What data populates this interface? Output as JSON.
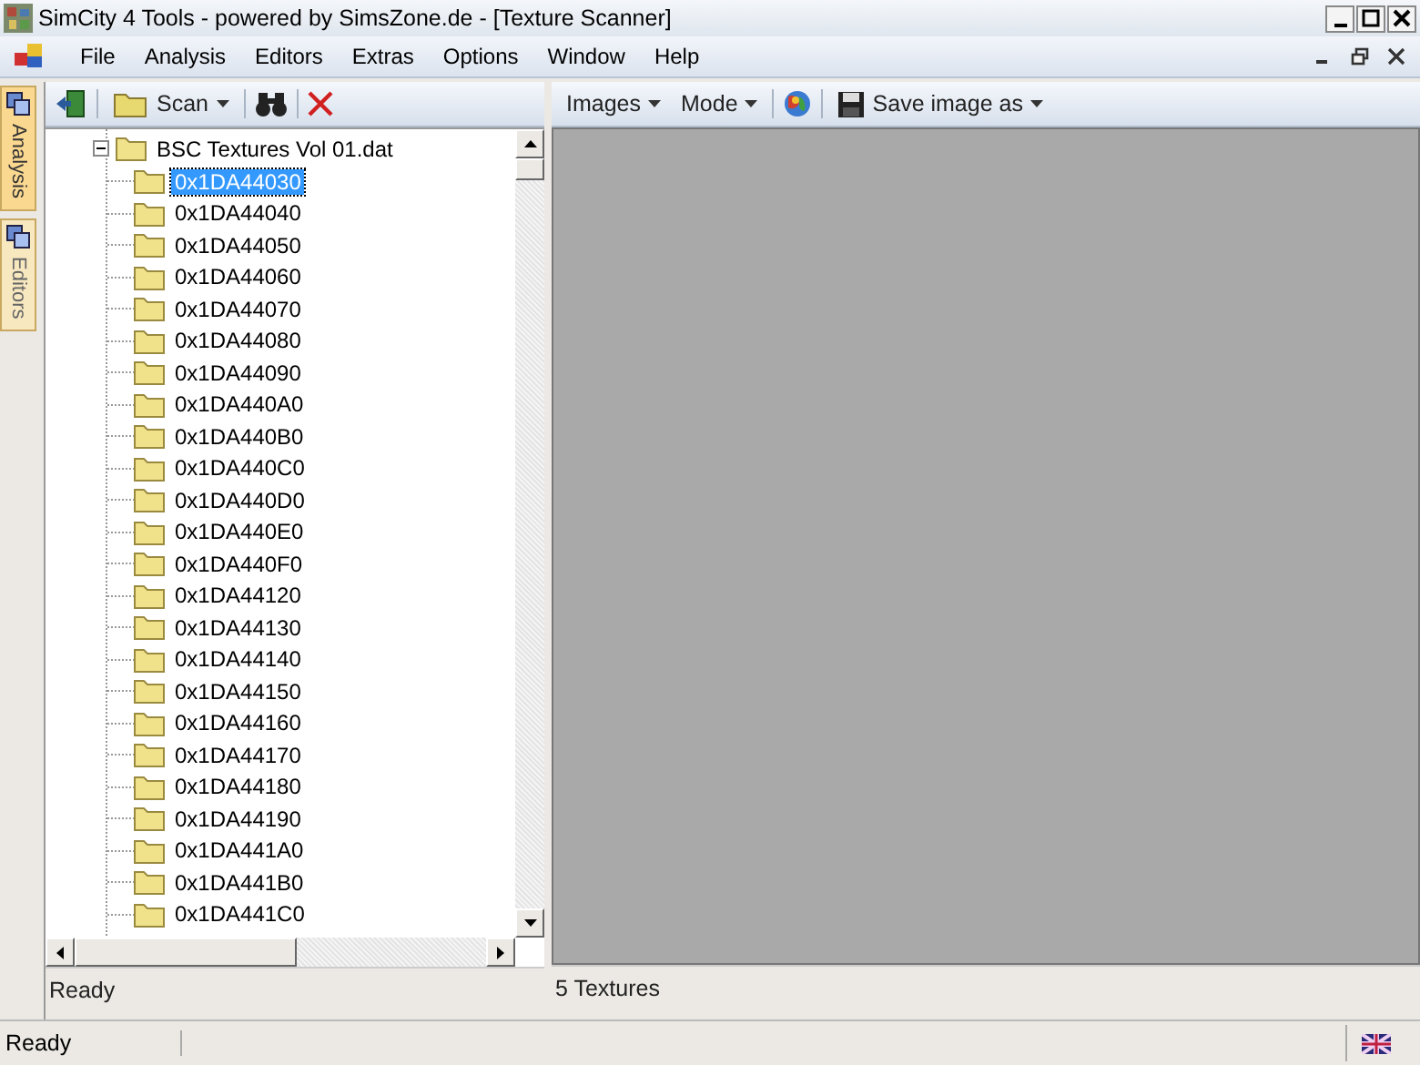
{
  "window": {
    "title": "SimCity 4 Tools - powered by SimsZone.de - [Texture Scanner]"
  },
  "menu": [
    "File",
    "Analysis",
    "Editors",
    "Extras",
    "Options",
    "Window",
    "Help"
  ],
  "side_tabs": [
    {
      "label": "Analysis",
      "selected": true
    },
    {
      "label": "Editors",
      "selected": false
    }
  ],
  "left_toolbar": {
    "scan_label": "Scan"
  },
  "tree": {
    "label": "BSC Textures Vol 01.dat",
    "expanded": true,
    "children": [
      {
        "label": "0x1DA44030",
        "selected": true
      },
      {
        "label": "0x1DA44040",
        "selected": false
      },
      {
        "label": "0x1DA44050",
        "selected": false
      },
      {
        "label": "0x1DA44060",
        "selected": false
      },
      {
        "label": "0x1DA44070",
        "selected": false
      },
      {
        "label": "0x1DA44080",
        "selected": false
      },
      {
        "label": "0x1DA44090",
        "selected": false
      },
      {
        "label": "0x1DA440A0",
        "selected": false
      },
      {
        "label": "0x1DA440B0",
        "selected": false
      },
      {
        "label": "0x1DA440C0",
        "selected": false
      },
      {
        "label": "0x1DA440D0",
        "selected": false
      },
      {
        "label": "0x1DA440E0",
        "selected": false
      },
      {
        "label": "0x1DA440F0",
        "selected": false
      },
      {
        "label": "0x1DA44120",
        "selected": false
      },
      {
        "label": "0x1DA44130",
        "selected": false
      },
      {
        "label": "0x1DA44140",
        "selected": false
      },
      {
        "label": "0x1DA44150",
        "selected": false
      },
      {
        "label": "0x1DA44160",
        "selected": false
      },
      {
        "label": "0x1DA44170",
        "selected": false
      },
      {
        "label": "0x1DA44180",
        "selected": false
      },
      {
        "label": "0x1DA44190",
        "selected": false
      },
      {
        "label": "0x1DA441A0",
        "selected": false
      },
      {
        "label": "0x1DA441B0",
        "selected": false
      },
      {
        "label": "0x1DA441C0",
        "selected": false
      }
    ]
  },
  "right_toolbar": {
    "images_label": "Images",
    "mode_label": "Mode",
    "save_label": "Save image as"
  },
  "left_status": "Ready",
  "right_status": "5 Textures",
  "status_bar": "Ready"
}
